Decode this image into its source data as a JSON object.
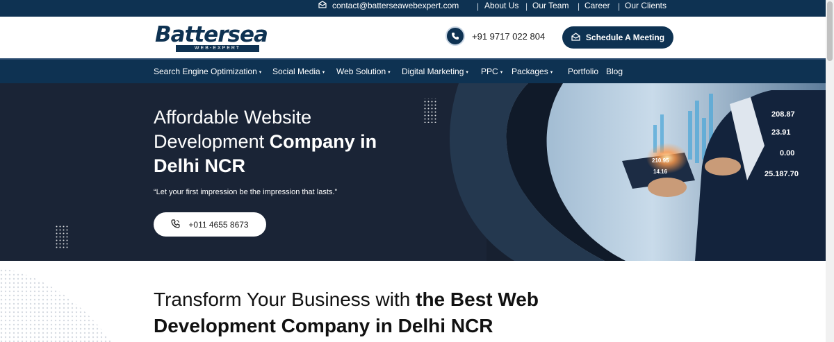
{
  "topbar": {
    "email": "contact@batterseawebexpert.com",
    "links": [
      "About Us",
      "Our Team",
      "Career",
      "Our Clients"
    ],
    "separator": "|"
  },
  "header": {
    "logo_text": "Battersea",
    "logo_tagline": "WEB-EXPERT",
    "phone": "+91 9717 022 804",
    "meeting_button": "Schedule A Meeting"
  },
  "nav": {
    "items": [
      {
        "label": "Search Engine Optimization",
        "dropdown": true
      },
      {
        "label": "Social Media",
        "dropdown": true
      },
      {
        "label": "Web Solution",
        "dropdown": true
      },
      {
        "label": "Digital Marketing",
        "dropdown": true
      },
      {
        "label": "PPC",
        "dropdown": true
      },
      {
        "label": "Packages",
        "dropdown": true
      },
      {
        "label": "Portfolio",
        "dropdown": false
      },
      {
        "label": "Blog",
        "dropdown": false
      }
    ]
  },
  "hero": {
    "title_line1": "Affordable Website",
    "title_line2_light": "Development ",
    "title_line2_bold": "Company in",
    "title_line3_bold": "Delhi NCR",
    "quote": "“Let your first impression be the impression that lasts.”",
    "call_button": "+011 4655 8673",
    "graphic_numbers": [
      "208.87",
      "23.91",
      "0.00",
      "25.187.70",
      "210.95",
      "14.16"
    ]
  },
  "section": {
    "heading_light": "Transform Your Business with ",
    "heading_bold1": "the Best Web",
    "heading_bold2": "Development Company in Delhi NCR"
  },
  "colors": {
    "brand_navy": "#0e3252",
    "hero_dark": "#172030",
    "white": "#ffffff"
  },
  "icons": [
    "envelope-icon",
    "phone-icon",
    "mail-open-icon",
    "phone-call-icon",
    "chevron-down-icon"
  ]
}
